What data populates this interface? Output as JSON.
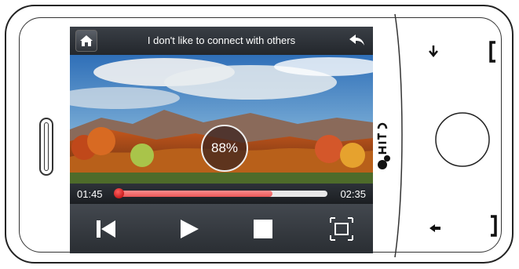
{
  "window": {
    "title": "I don't like to connect with others"
  },
  "topbar": {
    "home_icon": "home-icon",
    "back_icon": "back-arrow-icon"
  },
  "video": {
    "loading_percent_label": "88%"
  },
  "seek": {
    "current_time": "01:45",
    "total_time": "02:35",
    "progress_fraction": 0.74
  },
  "controls": {
    "items": [
      "previous-track-icon",
      "play-icon",
      "stop-icon",
      "fullscreen-icon"
    ]
  },
  "device": {
    "brand": "htc"
  },
  "colors": {
    "seek_fill": "#e85858",
    "topbar": "#2d3238",
    "knob": "#c00000"
  }
}
